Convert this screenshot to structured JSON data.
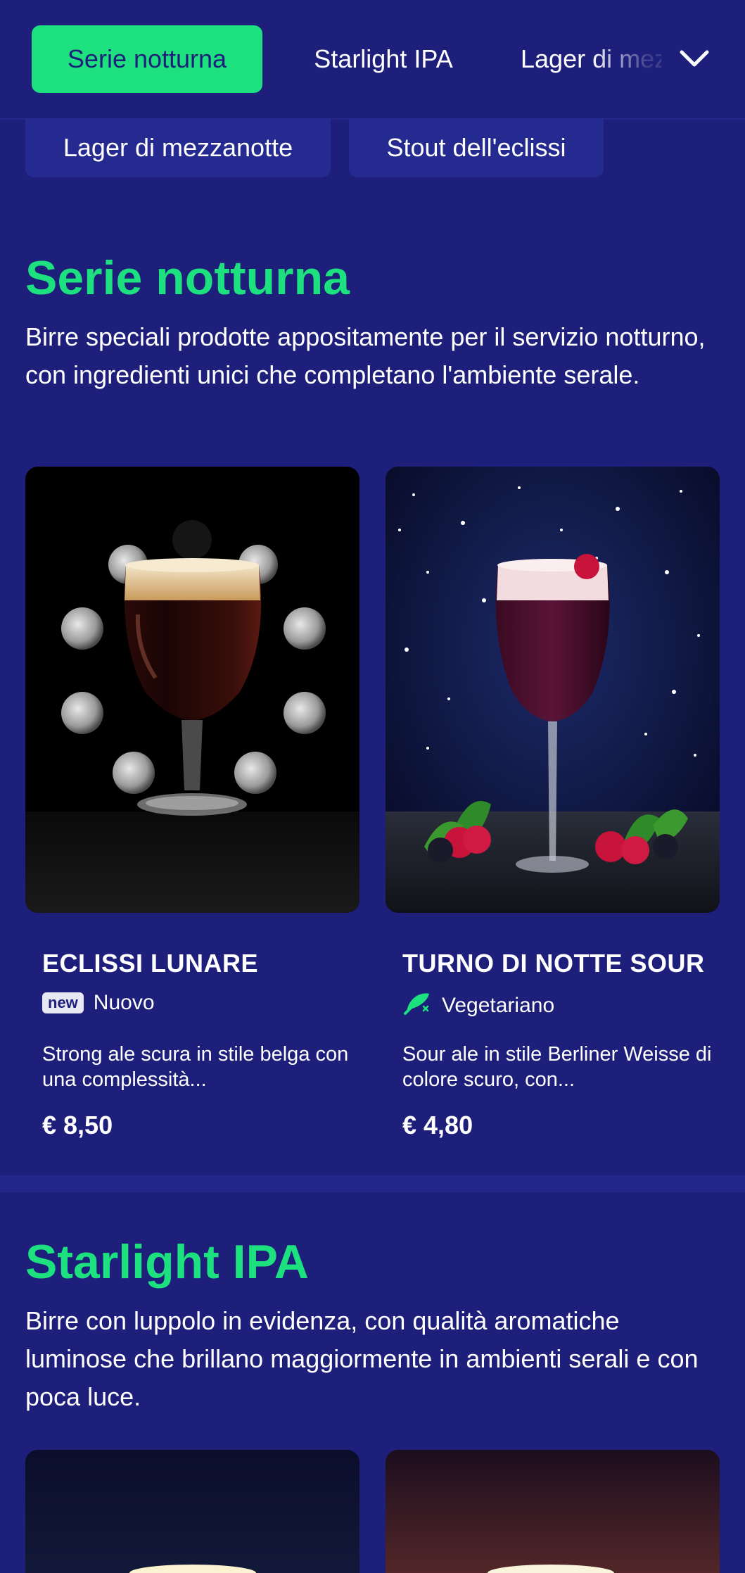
{
  "nav": {
    "tabs": [
      {
        "label": "Serie notturna",
        "active": true
      },
      {
        "label": "Starlight IPA",
        "active": false
      },
      {
        "label": "Lager di mezzanotte",
        "active": false
      }
    ],
    "overflow_tabs": [
      {
        "label": "Lager di mezzanotte"
      },
      {
        "label": "Stout dell'eclissi"
      }
    ],
    "expand_icon": "chevron-down-icon"
  },
  "sections": [
    {
      "title": "Serie notturna",
      "description": "Birre speciali prodotte appositamente per il servizio notturno, con ingredienti unici che completano l'ambiente serale.",
      "items": [
        {
          "name": "ECLISSI LUNARE",
          "tag_badge": "new",
          "tag": "Nuovo",
          "description": "Strong ale scura in stile belga con una complessità...",
          "price": "€ 8,50"
        },
        {
          "name": "TURNO DI NOTTE SOUR",
          "tag_icon": "leaf-icon",
          "tag": "Vegetariano",
          "description": "Sour ale in stile Berliner Weisse di colore scuro, con...",
          "price": "€ 4,80"
        }
      ]
    },
    {
      "title": "Starlight IPA",
      "description": "Birre con luppolo in evidenza, con qualità aromatiche luminose che brillano maggiormente in ambienti serali e con poca luce."
    }
  ],
  "colors": {
    "background": "#1e1f7a",
    "accent": "#1de07f",
    "tab_bg": "#242a90"
  }
}
